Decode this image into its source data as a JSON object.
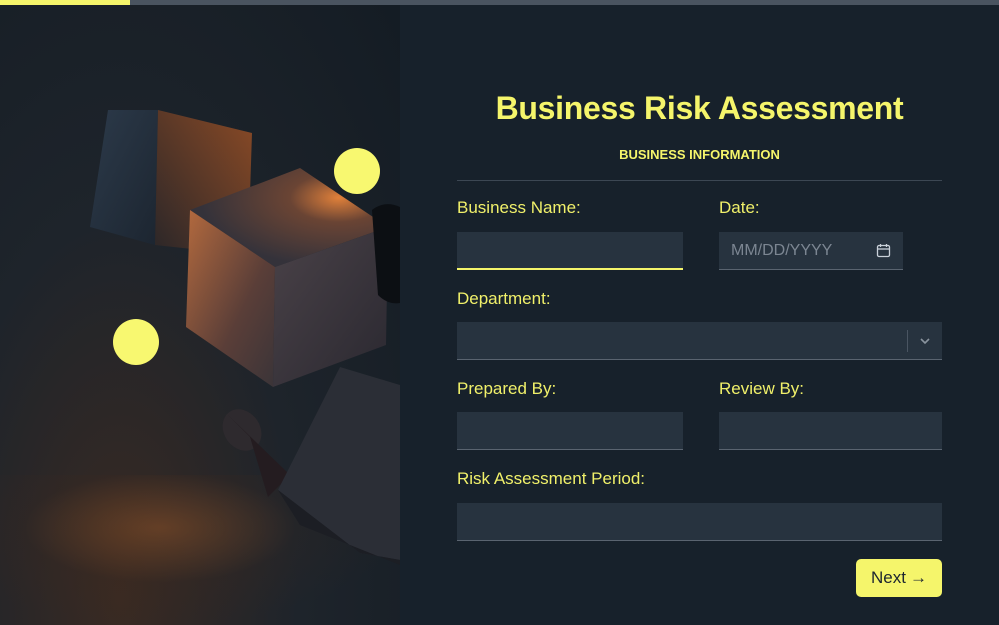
{
  "progress": {
    "value_percent": 13,
    "color": "#f5f56b"
  },
  "colors": {
    "accent": "#f5f56b",
    "background": "#16202a",
    "field_bg": "#27333f"
  },
  "form": {
    "title": "Business Risk Assessment",
    "section": "BUSINESS INFORMATION",
    "fields": {
      "business_name": {
        "label": "Business Name:",
        "value": ""
      },
      "date": {
        "label": "Date:",
        "placeholder": "MM/DD/YYYY",
        "icon": "calendar-icon"
      },
      "department": {
        "label": "Department:",
        "selected": "",
        "icon": "chevron-down-icon"
      },
      "prepared_by": {
        "label": "Prepared By:",
        "value": ""
      },
      "review_by": {
        "label": "Review By:",
        "value": ""
      },
      "risk_period": {
        "label": "Risk Assessment Period:",
        "value": ""
      }
    },
    "next_button": {
      "label": "Next",
      "icon": "arrow-right-icon",
      "arrow": "→"
    }
  }
}
